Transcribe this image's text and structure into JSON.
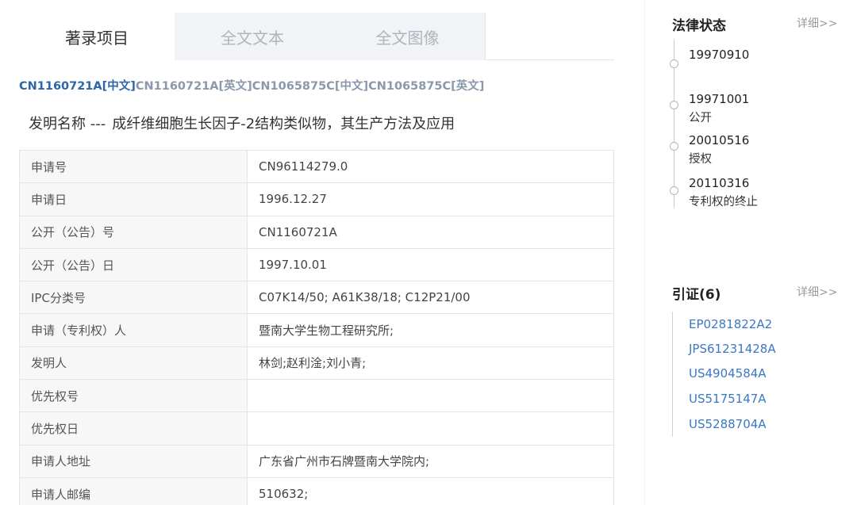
{
  "tabs": [
    {
      "label": "著录项目",
      "active": true
    },
    {
      "label": "全文文本",
      "active": false
    },
    {
      "label": "全文图像",
      "active": false
    }
  ],
  "publication_links": [
    {
      "number": "CN1160721A",
      "lang": "[中文]",
      "current": true
    },
    {
      "number": "CN1160721A",
      "lang": "[英文]",
      "current": false
    },
    {
      "number": "CN1065875C",
      "lang": "[中文]",
      "current": false
    },
    {
      "number": "CN1065875C",
      "lang": "[英文]",
      "current": false
    }
  ],
  "invention": {
    "label": "发明名称 ---",
    "name": "成纤维细胞生长因子-2结构类似物，其生产方法及应用"
  },
  "biblio": [
    {
      "key": "申请号",
      "value": "CN96114279.0"
    },
    {
      "key": "申请日",
      "value": "1996.12.27"
    },
    {
      "key": "公开（公告）号",
      "value": "CN1160721A"
    },
    {
      "key": "公开（公告）日",
      "value": "1997.10.01"
    },
    {
      "key": "IPC分类号",
      "value": "C07K14/50; A61K38/18; C12P21/00"
    },
    {
      "key": "申请（专利权）人",
      "value": "暨南大学生物工程研究所;"
    },
    {
      "key": "发明人",
      "value": "林剑;赵利淦;刘小青;"
    },
    {
      "key": "优先权号",
      "value": ""
    },
    {
      "key": "优先权日",
      "value": ""
    },
    {
      "key": "申请人地址",
      "value": "广东省广州市石牌暨南大学院内;"
    },
    {
      "key": "申请人邮编",
      "value": "510632;"
    }
  ],
  "legal_status": {
    "title": "法律状态",
    "more": "详细>>",
    "events": [
      {
        "date": "19970910",
        "desc": ""
      },
      {
        "date": "19971001",
        "desc": "公开"
      },
      {
        "date": "20010516",
        "desc": "授权"
      },
      {
        "date": "20110316",
        "desc": "专利权的终止"
      }
    ]
  },
  "citations": {
    "title": "引证(6)",
    "more": "详细>>",
    "items": [
      "EP0281822A2",
      "JPS61231428A",
      "US4904584A",
      "US5175147A",
      "US5288704A"
    ]
  },
  "colors": {
    "link_blue": "#3b78c4",
    "current_pub": "#2d65a9",
    "other_pub": "#8a98ab",
    "tab_inactive_bg": "#f2f3f7"
  }
}
